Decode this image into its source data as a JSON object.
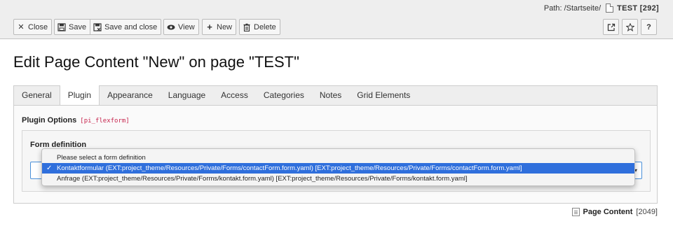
{
  "path": {
    "label": "Path:",
    "segment": "/Startseite/",
    "page_title": "TEST [292]"
  },
  "toolbar": {
    "close": "Close",
    "save": "Save",
    "save_and_close": "Save and close",
    "view": "View",
    "new": "New",
    "delete": "Delete",
    "help": "?"
  },
  "heading": "Edit Page Content \"New\" on page \"TEST\"",
  "tabs": [
    "General",
    "Plugin",
    "Appearance",
    "Language",
    "Access",
    "Categories",
    "Notes",
    "Grid Elements"
  ],
  "active_tab": "Plugin",
  "plugin": {
    "section_title": "Plugin Options",
    "section_code": "[pi_flexform]",
    "field_label": "Form definition"
  },
  "dropdown": {
    "options": [
      "Please select a form definition",
      "Kontaktformular (EXT:project_theme/Resources/Private/Forms/contactForm.form.yaml) [EXT:project_theme/Resources/Private/Forms/contactForm.form.yaml]",
      "Anfrage (EXT:project_theme/Resources/Private/Forms/kontakt.form.yaml) [EXT:project_theme/Resources/Private/Forms/kontakt.form.yaml]"
    ],
    "selected_index": 1,
    "check_mark": "✓"
  },
  "record": {
    "type": "Page Content",
    "id": "[2049]"
  },
  "colors": {
    "selection": "#2f6fdc",
    "code": "#c7254e",
    "focus_border": "#4a90d9"
  }
}
